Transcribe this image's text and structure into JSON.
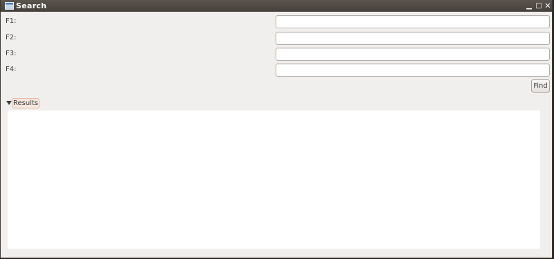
{
  "window": {
    "title": "Search",
    "controls": {
      "minimize": "▁",
      "maximize": "□",
      "close": "✕"
    }
  },
  "form": {
    "fields": [
      {
        "label": "F1:",
        "value": ""
      },
      {
        "label": "F2:",
        "value": ""
      },
      {
        "label": "F3:",
        "value": ""
      },
      {
        "label": "F4:",
        "value": ""
      }
    ],
    "find_label": "Find"
  },
  "results": {
    "label": "Results",
    "expanded": true
  },
  "colors": {
    "titlebar": "#4f4a44",
    "background": "#f1efed",
    "expander_highlight": "#e8b9a4"
  },
  "icons": {
    "app": "window-icon",
    "expander": "triangle-down-icon"
  }
}
